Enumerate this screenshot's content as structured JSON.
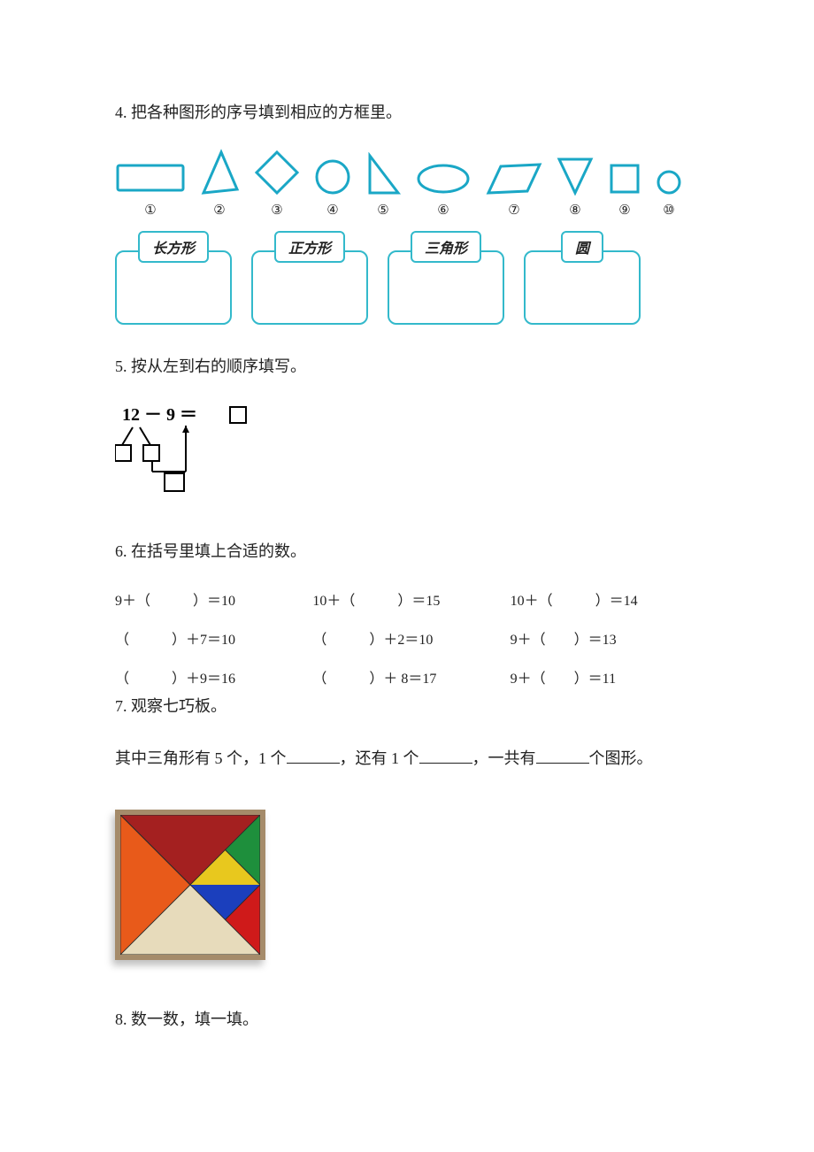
{
  "q4": {
    "text": "4. 把各种图形的序号填到相应的方框里。",
    "shape_labels": [
      "①",
      "②",
      "③",
      "④",
      "⑤",
      "⑥",
      "⑦",
      "⑧",
      "⑨",
      "⑩"
    ],
    "box_labels": [
      "长方形",
      "正方形",
      "三角形",
      "圆"
    ]
  },
  "q5": {
    "text": "5. 按从左到右的顺序填写。",
    "equation": "12 － 9 ＝ □"
  },
  "q6": {
    "text": "6. 在括号里填上合适的数。",
    "rows": [
      [
        "9＋（　　　）＝10",
        "10＋（　　　）＝15",
        "10＋（　　　）＝14"
      ],
      [
        "（　　　）＋7＝10",
        "（　　　）＋2＝10",
        "9＋（　　）＝13"
      ],
      [
        "（　　　）＋9＝16",
        "（　　　）＋ 8＝17",
        "9＋（　　）＝11"
      ]
    ]
  },
  "q7": {
    "text": "7. 观察七巧板。",
    "parts": {
      "pre": "其中三角形有 5 个，1 个",
      "mid1": "，还有 1 个",
      "mid2": "，一共有",
      "post": "个图形。"
    }
  },
  "q8": {
    "text": "8. 数一数，填一填。"
  }
}
